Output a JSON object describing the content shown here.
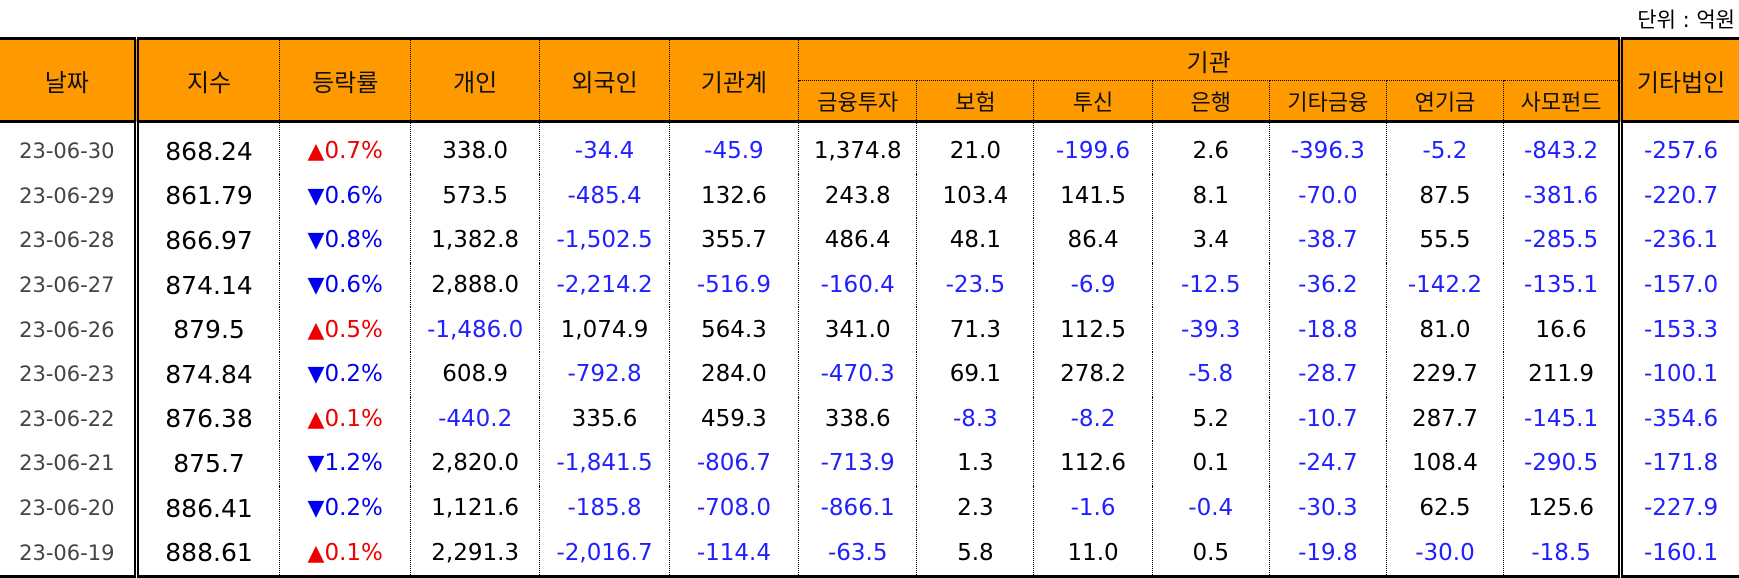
{
  "unit_label": "단위 : 억원",
  "headers": {
    "date": "날짜",
    "index": "지수",
    "change": "등락률",
    "individual": "개인",
    "foreign": "외국인",
    "inst_total": "기관계",
    "institution": "기관",
    "inst_sub": [
      "금융투자",
      "보험",
      "투신",
      "은행",
      "기타금융",
      "연기금",
      "사모펀드"
    ],
    "other_corp": "기타법인"
  },
  "rows": [
    {
      "date": "23-06-30",
      "index": "868.24",
      "dir": "up",
      "arrow": "▲",
      "rate": "0.7%",
      "vals": [
        "338.0",
        "-34.4",
        "-45.9",
        "1,374.8",
        "21.0",
        "-199.6",
        "2.6",
        "-396.3",
        "-5.2",
        "-843.2",
        "-257.6"
      ]
    },
    {
      "date": "23-06-29",
      "index": "861.79",
      "dir": "down",
      "arrow": "▼",
      "rate": "0.6%",
      "vals": [
        "573.5",
        "-485.4",
        "132.6",
        "243.8",
        "103.4",
        "141.5",
        "8.1",
        "-70.0",
        "87.5",
        "-381.6",
        "-220.7"
      ]
    },
    {
      "date": "23-06-28",
      "index": "866.97",
      "dir": "down",
      "arrow": "▼",
      "rate": "0.8%",
      "vals": [
        "1,382.8",
        "-1,502.5",
        "355.7",
        "486.4",
        "48.1",
        "86.4",
        "3.4",
        "-38.7",
        "55.5",
        "-285.5",
        "-236.1"
      ]
    },
    {
      "date": "23-06-27",
      "index": "874.14",
      "dir": "down",
      "arrow": "▼",
      "rate": "0.6%",
      "vals": [
        "2,888.0",
        "-2,214.2",
        "-516.9",
        "-160.4",
        "-23.5",
        "-6.9",
        "-12.5",
        "-36.2",
        "-142.2",
        "-135.1",
        "-157.0"
      ]
    },
    {
      "date": "23-06-26",
      "index": "879.5",
      "dir": "up",
      "arrow": "▲",
      "rate": "0.5%",
      "vals": [
        "-1,486.0",
        "1,074.9",
        "564.3",
        "341.0",
        "71.3",
        "112.5",
        "-39.3",
        "-18.8",
        "81.0",
        "16.6",
        "-153.3"
      ]
    },
    {
      "date": "23-06-23",
      "index": "874.84",
      "dir": "down",
      "arrow": "▼",
      "rate": "0.2%",
      "vals": [
        "608.9",
        "-792.8",
        "284.0",
        "-470.3",
        "69.1",
        "278.2",
        "-5.8",
        "-28.7",
        "229.7",
        "211.9",
        "-100.1"
      ]
    },
    {
      "date": "23-06-22",
      "index": "876.38",
      "dir": "up",
      "arrow": "▲",
      "rate": "0.1%",
      "vals": [
        "-440.2",
        "335.6",
        "459.3",
        "338.6",
        "-8.3",
        "-8.2",
        "5.2",
        "-10.7",
        "287.7",
        "-145.1",
        "-354.6"
      ]
    },
    {
      "date": "23-06-21",
      "index": "875.7",
      "dir": "down",
      "arrow": "▼",
      "rate": "1.2%",
      "vals": [
        "2,820.0",
        "-1,841.5",
        "-806.7",
        "-713.9",
        "1.3",
        "112.6",
        "0.1",
        "-24.7",
        "108.4",
        "-290.5",
        "-171.8"
      ]
    },
    {
      "date": "23-06-20",
      "index": "886.41",
      "dir": "down",
      "arrow": "▼",
      "rate": "0.2%",
      "vals": [
        "1,121.6",
        "-185.8",
        "-708.0",
        "-866.1",
        "2.3",
        "-1.6",
        "-0.4",
        "-30.3",
        "62.5",
        "125.6",
        "-227.9"
      ]
    },
    {
      "date": "23-06-19",
      "index": "888.61",
      "dir": "up",
      "arrow": "▲",
      "rate": "0.1%",
      "vals": [
        "2,291.3",
        "-2,016.7",
        "-114.4",
        "-63.5",
        "5.8",
        "11.0",
        "0.5",
        "-19.8",
        "-30.0",
        "-18.5",
        "-160.1"
      ]
    }
  ],
  "colors": {
    "header_bg": "#ff9900",
    "negative": "#1f1fff",
    "up": "#ee0000",
    "down": "#0000ee"
  }
}
